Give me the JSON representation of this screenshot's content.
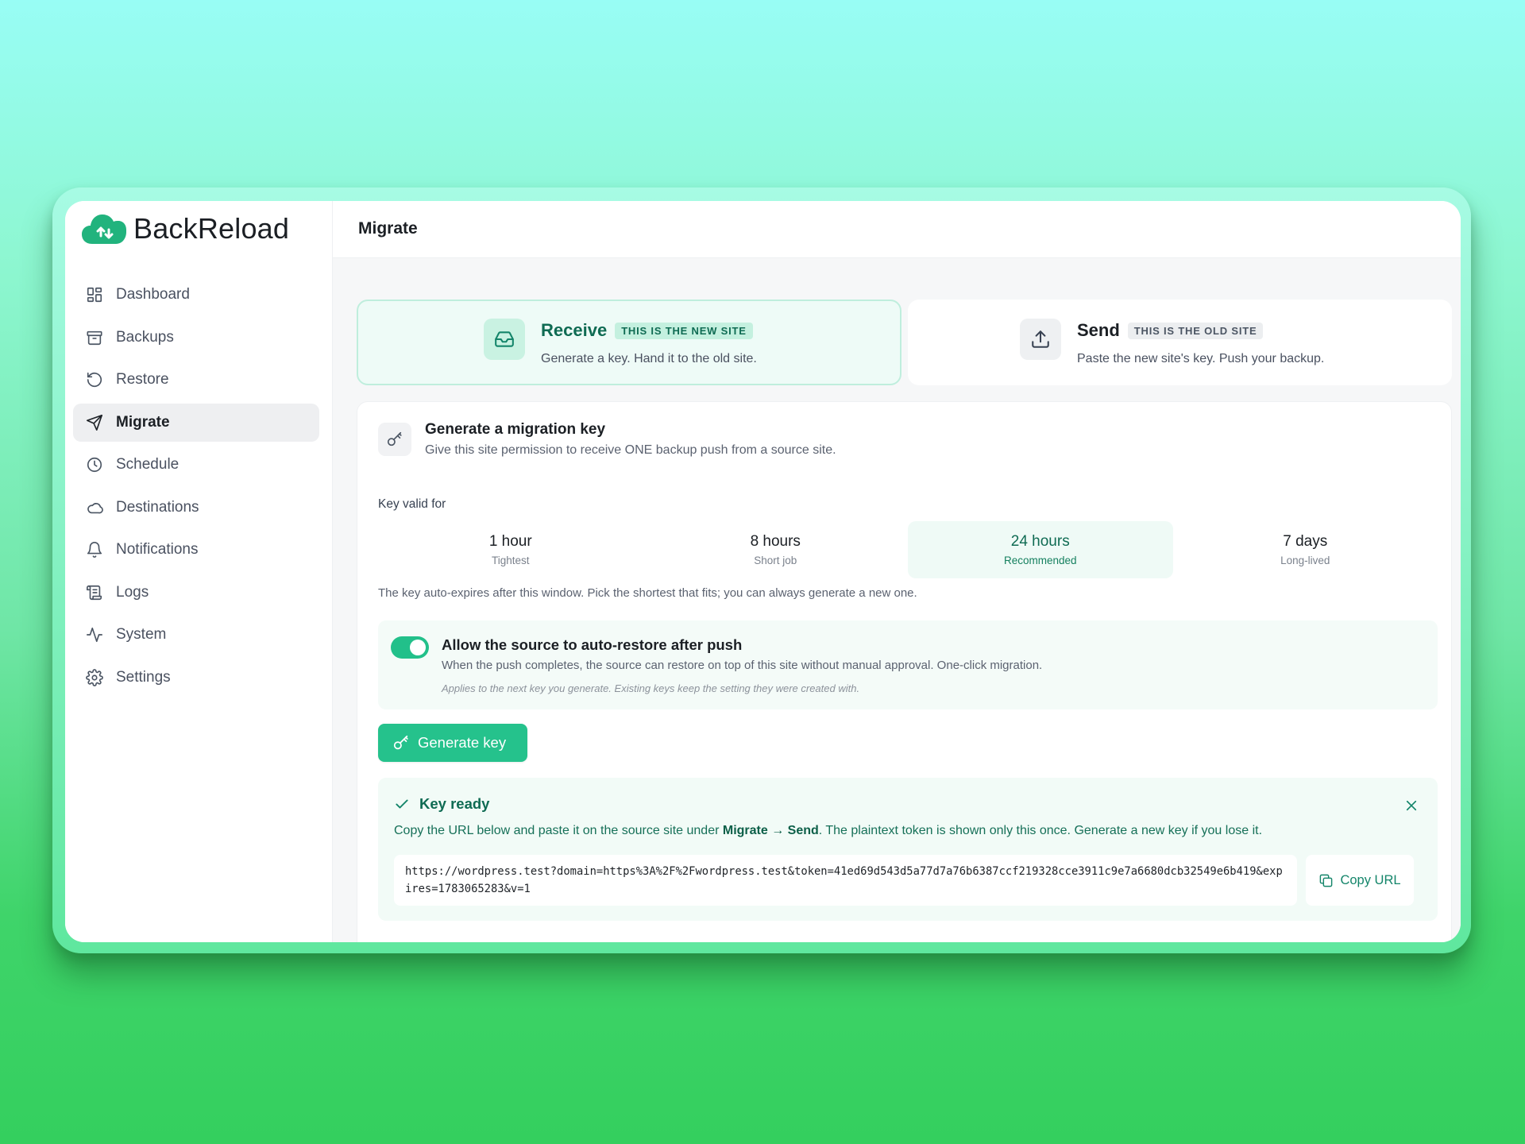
{
  "app": {
    "name": "BackReload"
  },
  "colors": {
    "accent": "#25c28c",
    "accent_dark": "#0f6b53",
    "accent_light": "#effaf6"
  },
  "sidebar": {
    "items": [
      {
        "label": "Dashboard",
        "icon": "dashboard-icon"
      },
      {
        "label": "Backups",
        "icon": "archive-icon"
      },
      {
        "label": "Restore",
        "icon": "restore-icon"
      },
      {
        "label": "Migrate",
        "icon": "send-icon",
        "active": true
      },
      {
        "label": "Schedule",
        "icon": "clock-icon"
      },
      {
        "label": "Destinations",
        "icon": "cloud-icon"
      },
      {
        "label": "Notifications",
        "icon": "bell-icon"
      },
      {
        "label": "Logs",
        "icon": "scroll-icon"
      },
      {
        "label": "System",
        "icon": "activity-icon"
      },
      {
        "label": "Settings",
        "icon": "gear-icon"
      }
    ]
  },
  "header": {
    "title": "Migrate"
  },
  "modes": {
    "receive": {
      "title": "Receive",
      "badge": "THIS IS THE NEW SITE",
      "description": "Generate a key. Hand it to the old site.",
      "icon": "inbox-icon",
      "selected": true
    },
    "send": {
      "title": "Send",
      "badge": "THIS IS THE OLD SITE",
      "description": "Paste the new site's key. Push your backup.",
      "icon": "upload-icon",
      "selected": false
    }
  },
  "panel": {
    "title": "Generate a migration key",
    "subtitle": "Give this site permission to receive ONE backup push from a source site.",
    "icon": "key-icon"
  },
  "validity": {
    "label": "Key valid for",
    "options": [
      {
        "title": "1 hour",
        "sub": "Tightest"
      },
      {
        "title": "8 hours",
        "sub": "Short job"
      },
      {
        "title": "24 hours",
        "sub": "Recommended",
        "selected": true
      },
      {
        "title": "7 days",
        "sub": "Long-lived"
      }
    ],
    "note": "The key auto-expires after this window. Pick the shortest that fits; you can always generate a new one."
  },
  "auto_restore": {
    "enabled": true,
    "title": "Allow the source to auto-restore after push",
    "description": "When the push completes, the source can restore on top of this site without manual approval. One-click migration.",
    "note": "Applies to the next key you generate. Existing keys keep the setting they were created with."
  },
  "generate_button": {
    "label": "Generate key"
  },
  "key_ready": {
    "title": "Key ready",
    "desc_prefix": "Copy the URL below and paste it on the source site under ",
    "desc_bold": "Migrate → Send",
    "desc_suffix": ". The plaintext token is shown only this once. Generate a new key if you lose it.",
    "url": "https://wordpress.test?domain=https%3A%2F%2Fwordpress.test&token=41ed69d543d5a77d7a76b6387ccf219328cce3911c9e7a6680dcb32549e6b419&expires=1783065283&v=1",
    "copy_label": "Copy URL"
  }
}
